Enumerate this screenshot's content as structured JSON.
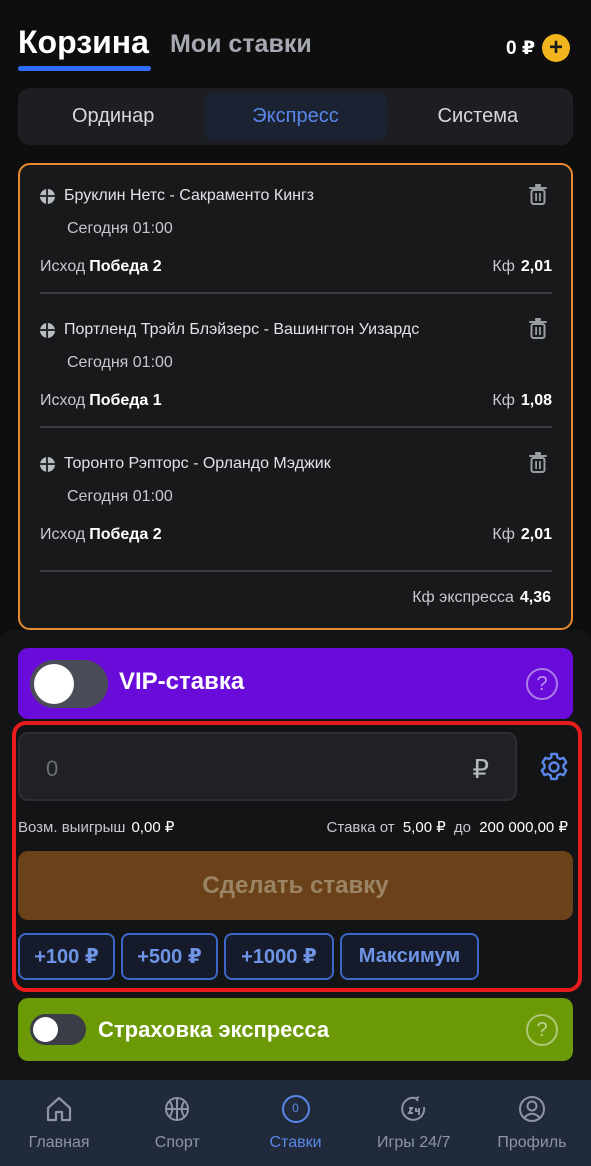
{
  "header": {
    "tab_cart": "Корзина",
    "tab_my_bets": "Мои ставки",
    "balance": "0 ₽",
    "add_symbol": "+"
  },
  "bet_types": [
    {
      "label": "Ординар",
      "active": false
    },
    {
      "label": "Экспресс",
      "active": true
    },
    {
      "label": "Система",
      "active": false
    }
  ],
  "bets": [
    {
      "title": "Бруклин Нетс - Сакраменто Кингз",
      "time": "Сегодня 01:00",
      "outcome_label": "Исход",
      "outcome": "Победа 2",
      "kf_label": "Кф",
      "kf": "2,01"
    },
    {
      "title": "Портленд Трэйл Блэйзерс - Вашингтон Уизардс",
      "time": "Сегодня 01:00",
      "outcome_label": "Исход",
      "outcome": "Победа 1",
      "kf_label": "Кф",
      "kf": "1,08"
    },
    {
      "title": "Торонто Рэпторс - Орландо Мэджик",
      "time": "Сегодня 01:00",
      "outcome_label": "Исход",
      "outcome": "Победа 2",
      "kf_label": "Кф",
      "kf": "2,01"
    }
  ],
  "express": {
    "label": "Кф экспресса",
    "value": "4,36"
  },
  "vip": {
    "label": "VIP-ставка",
    "help": "?",
    "enabled": false
  },
  "stake": {
    "value": "0",
    "currency": "₽",
    "possible_win_label": "Возм. выигрыш",
    "possible_win": "0,00 ₽",
    "range_from_label": "Ставка от",
    "min": "5,00 ₽",
    "range_to_label": "до",
    "max": "200 000,00 ₽"
  },
  "place_bet": "Сделать ставку",
  "quick_amounts": [
    "+100 ₽",
    "+500 ₽",
    "+1000 ₽",
    "Максимум"
  ],
  "insurance": {
    "label": "Страховка экспресса",
    "help": "?",
    "enabled": false
  },
  "nav": [
    {
      "label": "Главная",
      "icon": "home-icon",
      "active": false
    },
    {
      "label": "Спорт",
      "icon": "basketball-icon",
      "active": false
    },
    {
      "label": "Ставки",
      "icon": "bets-icon",
      "badge": "0",
      "active": true
    },
    {
      "label": "Игры 24/7",
      "icon": "games-24-7-icon",
      "active": false
    },
    {
      "label": "Профиль",
      "icon": "profile-icon",
      "active": false
    }
  ],
  "colors": {
    "accent_blue": "#5a87e8",
    "highlight_orange": "#e88b2e",
    "vip_purple": "#6a0cd9",
    "insurance_green": "#6c9a06",
    "bet_button_brown": "#6a4118",
    "stake_box_red": "#e81c1c"
  }
}
